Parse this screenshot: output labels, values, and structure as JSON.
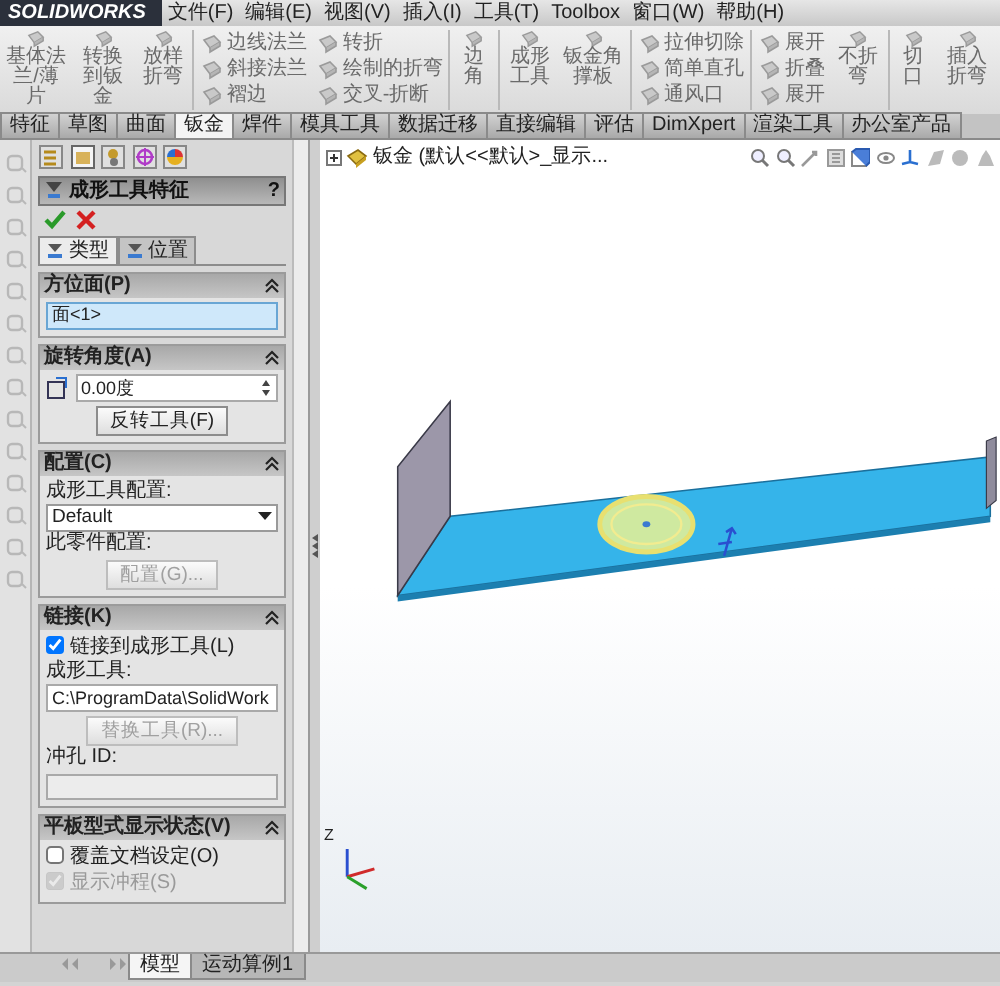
{
  "title_bar": {
    "logo": "SOLIDWORKS",
    "menu": [
      "文件(F)",
      "编辑(E)",
      "视图(V)",
      "插入(I)",
      "工具(T)",
      "Toolbox",
      "窗口(W)",
      "帮助(H)"
    ]
  },
  "ribbon": [
    {
      "items": [
        {
          "kind": "large",
          "label": "基体法兰/薄片"
        },
        {
          "kind": "large",
          "label": "转换到钣金"
        },
        {
          "kind": "large",
          "label": "放样折弯"
        }
      ]
    },
    {
      "items": [
        {
          "kind": "column",
          "labels": [
            "边线法兰",
            "斜接法兰",
            "褶边"
          ]
        },
        {
          "kind": "column",
          "labels": [
            "转折",
            "绘制的折弯",
            "交叉-折断"
          ]
        }
      ]
    },
    {
      "items": [
        {
          "kind": "large",
          "label": "边角"
        }
      ]
    },
    {
      "items": [
        {
          "kind": "large",
          "label": "成形工具"
        },
        {
          "kind": "large",
          "label": "钣金角撑板"
        }
      ]
    },
    {
      "items": [
        {
          "kind": "column",
          "labels": [
            "拉伸切除",
            "简单直孔",
            "通风口"
          ]
        }
      ]
    },
    {
      "items": [
        {
          "kind": "column",
          "labels": [
            "展开",
            "折叠",
            "展开"
          ]
        },
        {
          "kind": "large",
          "label": "不折弯"
        }
      ]
    },
    {
      "items": [
        {
          "kind": "large",
          "label": "切口"
        },
        {
          "kind": "large",
          "label": "插入折弯"
        }
      ]
    }
  ],
  "command_tabs": [
    {
      "label": "特征",
      "selected": false
    },
    {
      "label": "草图",
      "selected": false
    },
    {
      "label": "曲面",
      "selected": false
    },
    {
      "label": "钣金",
      "selected": true
    },
    {
      "label": "焊件",
      "selected": false
    },
    {
      "label": "模具工具",
      "selected": false
    },
    {
      "label": "数据迁移",
      "selected": false
    },
    {
      "label": "直接编辑",
      "selected": false
    },
    {
      "label": "评估",
      "selected": false
    },
    {
      "label": "DimXpert",
      "selected": false
    },
    {
      "label": "渲染工具",
      "selected": false
    },
    {
      "label": "办公室产品",
      "selected": false
    }
  ],
  "property_manager": {
    "title": "成形工具特征",
    "help": "?",
    "tabs": [
      {
        "label": "类型",
        "selected": true
      },
      {
        "label": "位置",
        "selected": false
      }
    ],
    "groups": [
      {
        "title": "方位面(P)",
        "items": [
          {
            "kind": "field",
            "value": "面<1>",
            "active": true
          }
        ]
      },
      {
        "title": "旋转角度(A)",
        "items": [
          {
            "kind": "spinner",
            "value": "0.00度"
          },
          {
            "kind": "button",
            "label": "反转工具(F)",
            "disabled": false
          }
        ]
      },
      {
        "title": "配置(C)",
        "items": [
          {
            "kind": "label",
            "text": "成形工具配置:"
          },
          {
            "kind": "select",
            "value": "Default"
          },
          {
            "kind": "label",
            "text": "此零件配置:"
          },
          {
            "kind": "button",
            "label": "配置(G)...",
            "disabled": true
          }
        ]
      },
      {
        "title": "链接(K)",
        "items": [
          {
            "kind": "checkbox",
            "label": "链接到成形工具(L)",
            "checked": true,
            "disabled": false
          },
          {
            "kind": "label",
            "text": "成形工具:"
          },
          {
            "kind": "field",
            "value": "C:\\ProgramData\\SolidWork",
            "active": false
          },
          {
            "kind": "button",
            "label": "替换工具(R)...",
            "disabled": true
          },
          {
            "kind": "label",
            "text": "冲孔 ID:"
          },
          {
            "kind": "empty_field"
          }
        ]
      },
      {
        "title": "平板型式显示状态(V)",
        "items": [
          {
            "kind": "checkbox",
            "label": "覆盖文档设定(O)",
            "checked": false,
            "disabled": false
          },
          {
            "kind": "checkbox",
            "label": "显示冲程(S)",
            "checked": true,
            "disabled": true
          }
        ]
      }
    ]
  },
  "viewport": {
    "tree_root": "钣金 (默认<<默认>_显示...",
    "axis_label": "Z"
  },
  "bottom_tabs": [
    {
      "label": "模型",
      "selected": true
    },
    {
      "label": "运动算例1",
      "selected": false
    }
  ]
}
